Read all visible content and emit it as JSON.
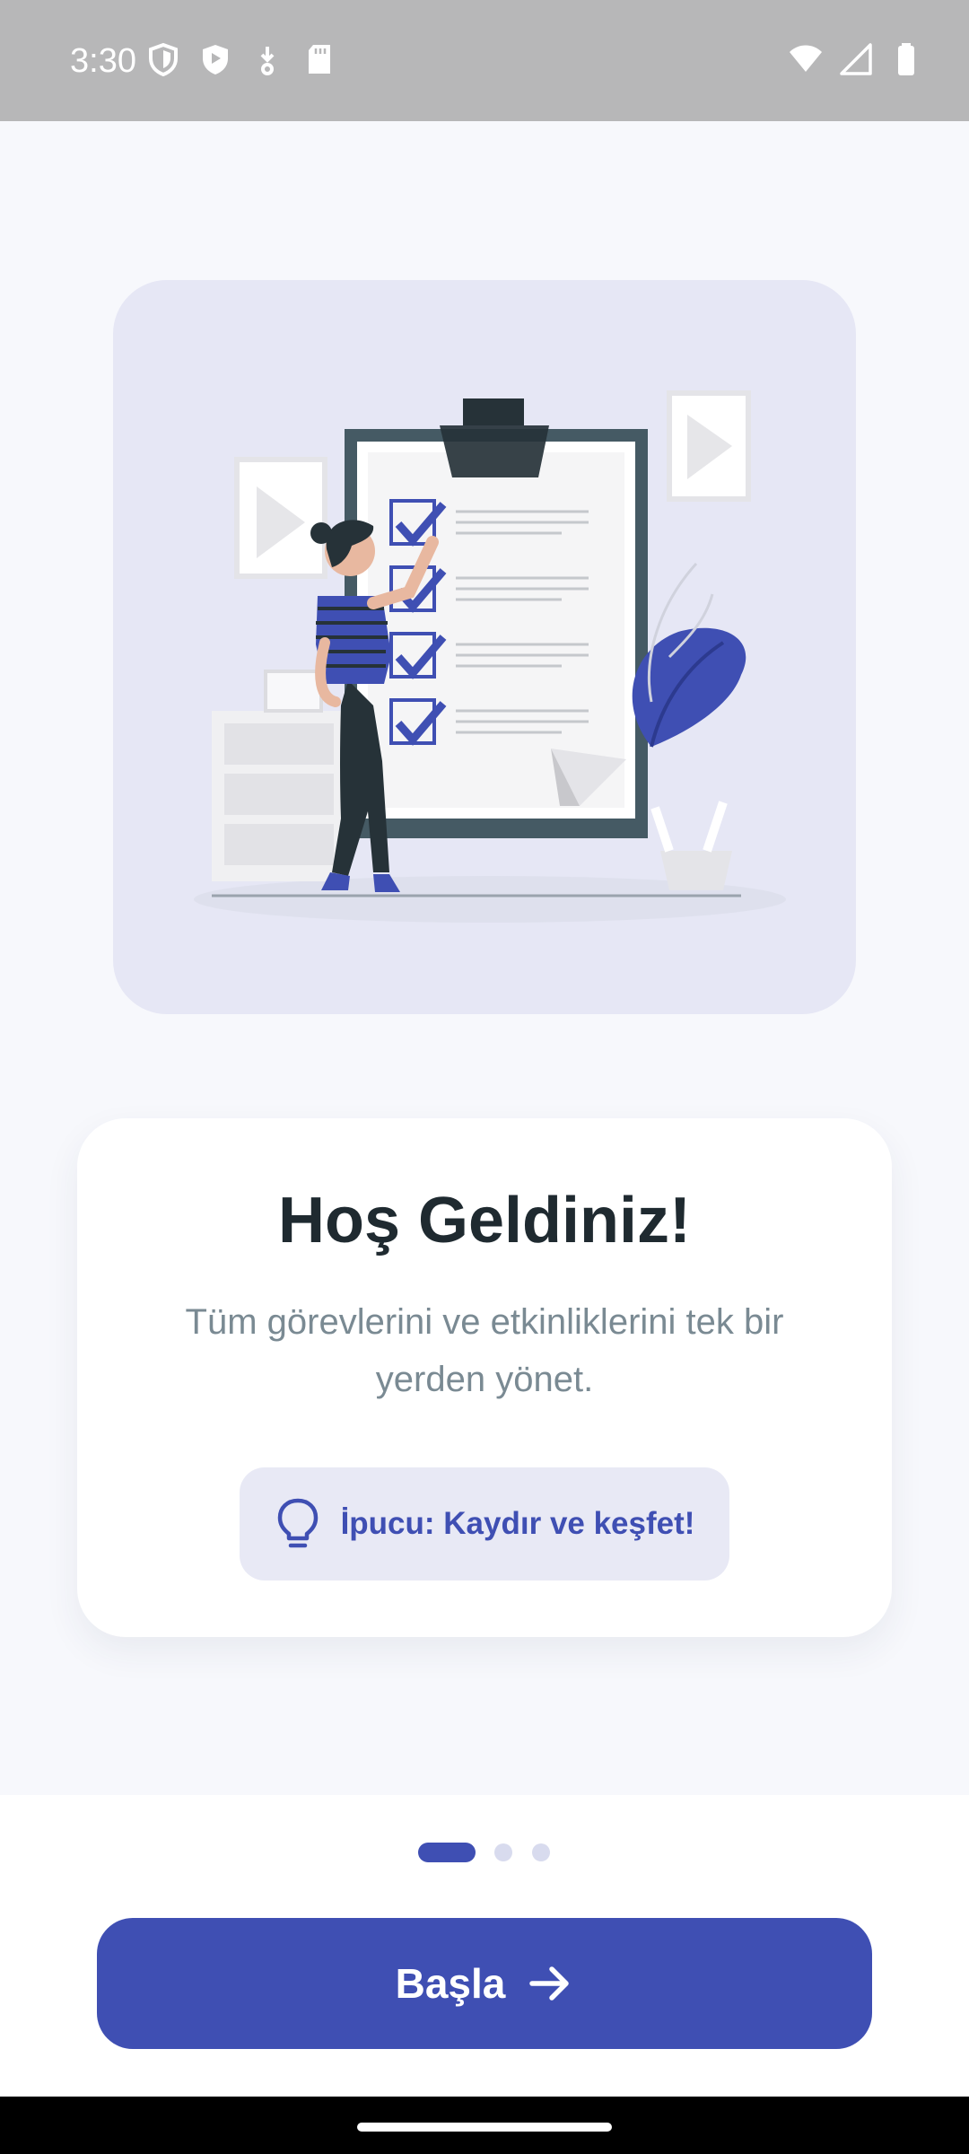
{
  "status_bar": {
    "time": "3:30",
    "left_icons": [
      "shield-outline-icon",
      "play-shield-icon",
      "download-icon",
      "sd-card-icon"
    ],
    "right_icons": [
      "wifi-icon",
      "signal-icon",
      "battery-icon"
    ]
  },
  "illustration": {
    "icon": "checklist-illustration"
  },
  "welcome": {
    "title": "Hoş Geldiniz!",
    "subtitle": "Tüm görevlerini ve etkinliklerini tek bir yerden yönet.",
    "tip": "İpucu: Kaydır ve keşfet!"
  },
  "pager": {
    "total_pages": 3,
    "current_page": 1
  },
  "start_button": {
    "label": "Başla"
  },
  "colors": {
    "accent": "#3f4fb3",
    "background": "#f7f8fc",
    "card": "#ffffff",
    "illustration_bg": "#e6e7f5",
    "title": "#1f2a30",
    "subtitle": "#7a8a93",
    "tip_bg": "#e8e9f5",
    "dot_inactive": "#d8dbee"
  }
}
